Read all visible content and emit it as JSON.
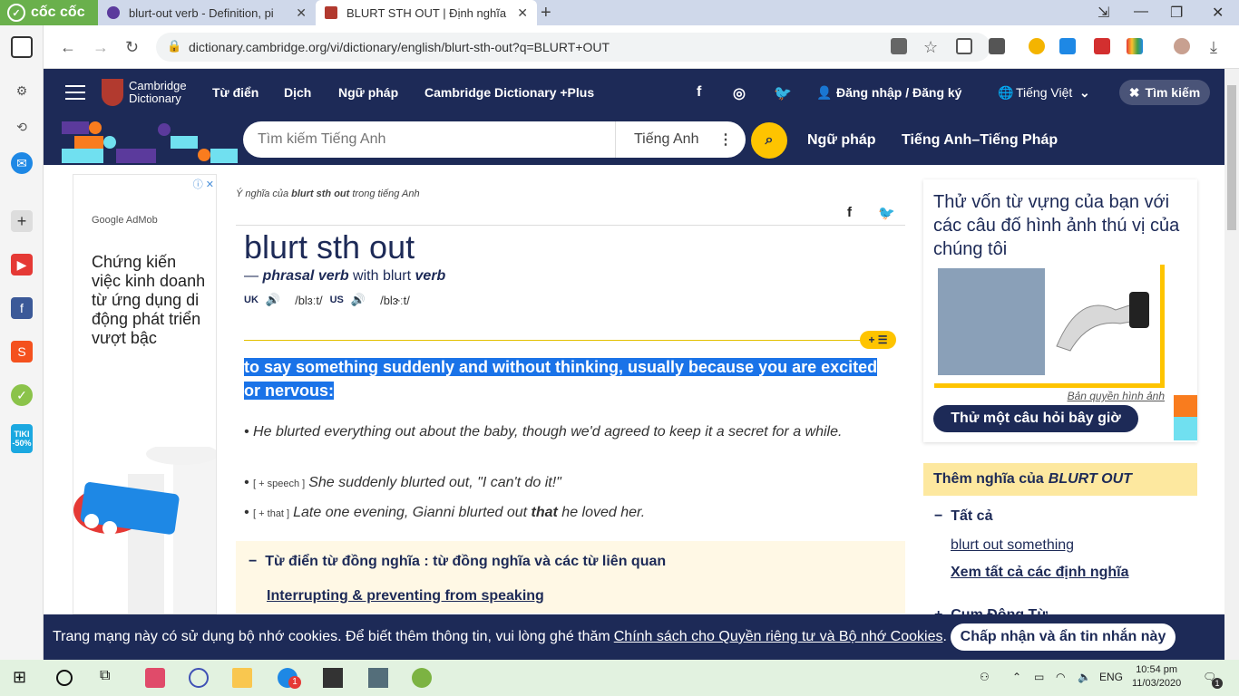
{
  "browser": {
    "brand": "cốc cốc",
    "tabs": [
      {
        "title": "blurt-out verb - Definition, pi"
      },
      {
        "title": "BLURT STH OUT | Định nghĩa"
      }
    ],
    "url": "dictionary.cambridge.org/vi/dictionary/english/blurt-sth-out?q=BLURT+OUT"
  },
  "header": {
    "logo": "Cambridge Dictionary",
    "nav": [
      "Từ điển",
      "Dịch",
      "Ngữ pháp",
      "Cambridge Dictionary +Plus"
    ],
    "login": "Đăng nhập / Đăng ký",
    "language": "Tiếng Việt",
    "search_toggle": "Tìm kiếm"
  },
  "searchbar": {
    "placeholder": "Tìm kiếm Tiếng Anh",
    "dictionary": "Tiếng Anh",
    "links": [
      "Ngữ pháp",
      "Tiếng Anh–Tiếng Pháp"
    ]
  },
  "ad": {
    "brand": "Google AdMob",
    "headline": "Chứng kiến việc kinh doanh từ ứng dụng di động phát triển vượt bậc"
  },
  "entry": {
    "crumb_prefix": "Ý nghĩa của ",
    "crumb_word": "blurt sth out",
    "crumb_suffix": " trong tiếng Anh",
    "headword": "blurt sth out",
    "pos_dash": "— ",
    "pos": "phrasal verb",
    "pos_with": " with blurt ",
    "pos_verb": "verb",
    "uk_label": "UK",
    "uk_ipa": "/blɜːt/",
    "us_label": "US",
    "us_ipa": "/blɝːt/",
    "definition": "to say something suddenly and without thinking, usually because you are excited or nervous:",
    "examples": [
      {
        "gram": "",
        "text_before": "He blurted everything out about the baby, though we'd agreed to keep it a secret for a while.",
        "bold": "",
        "text_after": ""
      },
      {
        "gram": "[ + speech ]",
        "text_before": "She suddenly blurted out, \"I can't do it!\"",
        "bold": "",
        "text_after": ""
      },
      {
        "gram": "[ + that ]",
        "text_before": "Late one evening, Gianni blurted out ",
        "bold": "that",
        "text_after": " he loved her."
      }
    ],
    "synonyms_heading": "Từ điển từ đồng nghĩa : từ đồng nghĩa và các từ liên quan",
    "synonyms_link": "Interrupting & preventing from speaking"
  },
  "quiz": {
    "title": "Thử vốn từ vựng của bạn với các câu đố hình ảnh thú vị của chúng tôi",
    "credit": "Bản quyền hình ảnh",
    "button": "Thử một câu hỏi bây giờ"
  },
  "more": {
    "label": "Thêm nghĩa của ",
    "word": "BLURT OUT",
    "all_label": "Tất cả",
    "link": "blurt out something",
    "see_all": "Xem tất cả các định nghĩa",
    "partial": "Cụm Động Từ"
  },
  "cookie": {
    "text": "Trang mạng này có sử dụng bộ nhớ cookies. Để biết thêm thông tin, vui lòng ghé thăm",
    "link": "Chính sách cho Quyền riêng tư và Bộ nhớ Cookies",
    "button": "Chấp nhận và ẩn tin nhắn này"
  },
  "taskbar": {
    "lang": "ENG",
    "time": "10:54 pm",
    "date": "11/03/2020",
    "badge": "1",
    "notif_badge": "1"
  },
  "sidebar": {
    "badge": "TIKI -50%"
  }
}
